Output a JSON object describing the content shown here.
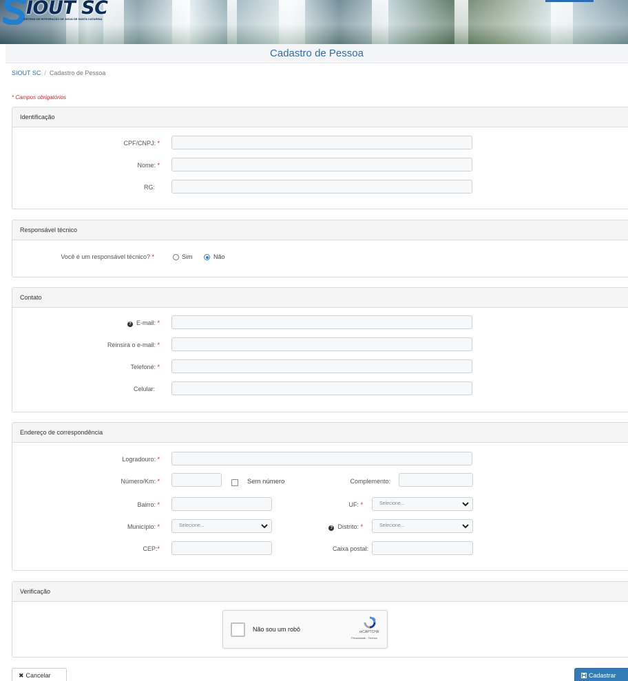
{
  "app": {
    "logo_text": "IOUT SC",
    "logo_subtitle": "SISTEMA DE INTEGRAÇÃO DE ÁGUA DE SANTA CATARINA"
  },
  "page": {
    "title": "Cadastro de Pessoa",
    "breadcrumb": [
      "SIOUT SC",
      "Cadastro de Pessoa"
    ],
    "required_note": "* Campos obrigatórios"
  },
  "sections": {
    "identificacao": {
      "title": "Identificação",
      "cpf_label": "CPF/CNPJ:",
      "nome_label": "Nome:",
      "rg_label": "RG:",
      "cpf_value": "",
      "nome_value": "",
      "rg_value": ""
    },
    "responsavel": {
      "title": "Responsável técnico",
      "question": "Você é um responsável técnico?",
      "options": [
        {
          "label": "Sim",
          "checked": false
        },
        {
          "label": "Não",
          "checked": true
        }
      ]
    },
    "contato": {
      "title": "Contato",
      "email_label": "E-mail:",
      "reemail_label": "Reinsira o e-mail:",
      "telefone_label": "Telefone:",
      "celular_label": "Celular:"
    },
    "endereco": {
      "title": "Endereço de correspondência",
      "logradouro_label": "Logradouro:",
      "numero_label": "Número/Km:",
      "sem_numero_label": "Sem número",
      "complemento_label": "Complemento:",
      "bairro_label": "Bairro:",
      "uf_label": "UF:",
      "uf_selected": "Selecione...",
      "municipio_label": "Município:",
      "municipio_selected": "Selecione...",
      "distrito_label": "Distrito:",
      "distrito_selected": "Selecione...",
      "cep_label": "CEP:",
      "caixa_postal_label": "Caixa postal:"
    },
    "verificacao": {
      "title": "Verificação",
      "captcha_text": "Não sou um robô",
      "captcha_brand": "reCAPTCHA",
      "captcha_terms": "Privacidade - Termos"
    }
  },
  "actions": {
    "cancel_label": "Cancelar",
    "submit_label": "Cadastrar"
  },
  "colors": {
    "primary": "#337ab7",
    "title_blue": "#2c6fb0",
    "required_red": "#d9262b"
  }
}
